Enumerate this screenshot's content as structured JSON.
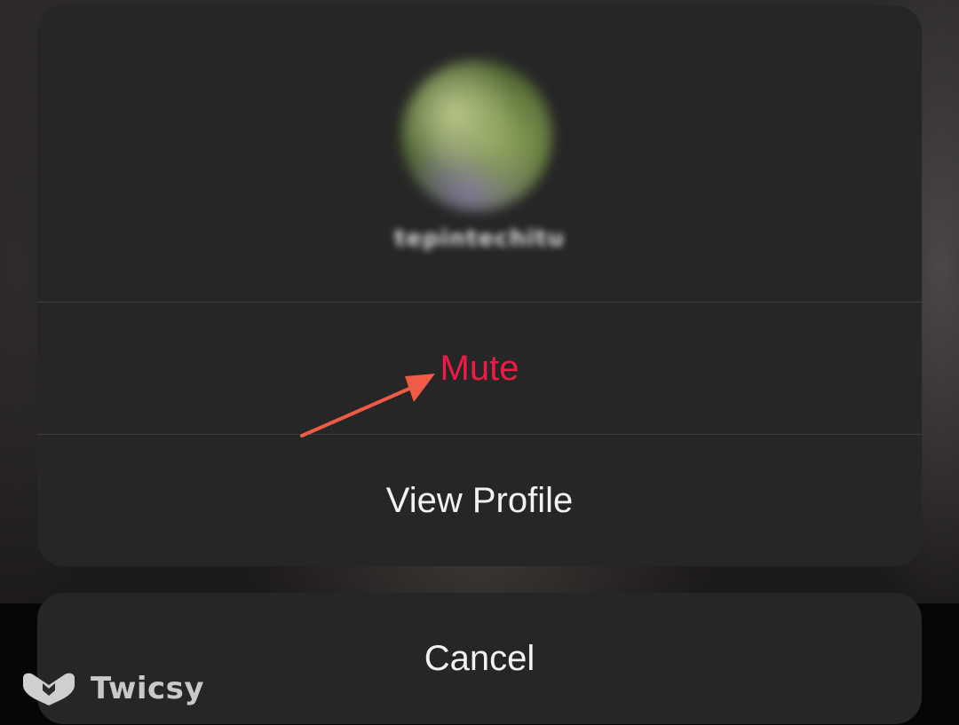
{
  "profile": {
    "username": "tepintechitu"
  },
  "actions": {
    "mute_label": "Mute",
    "view_profile_label": "View Profile",
    "cancel_label": "Cancel"
  },
  "watermark": {
    "text": "Twicsy"
  },
  "colors": {
    "sheet_background": "#262626",
    "destructive_text": "#ed1c46",
    "primary_text": "#f2f2f2",
    "annotation_arrow": "#ef5b45"
  },
  "icons": {
    "annotation": "arrow-icon",
    "watermark_logo": "twicsy-logo-icon"
  }
}
